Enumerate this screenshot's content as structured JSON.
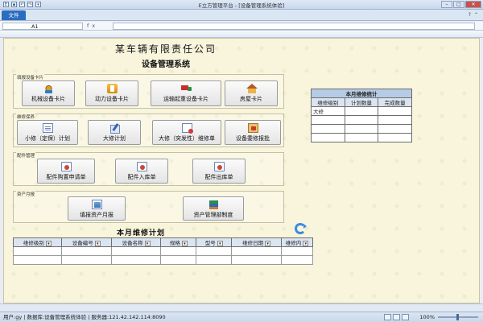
{
  "window": {
    "title": "E立方管理平台 - [设备管理系统体验]"
  },
  "ribbon": {
    "file_tab": "文件"
  },
  "formula_bar": {
    "name_box": "A1",
    "fx": "fx"
  },
  "sheet": {
    "company": "某车辆有限责任公司",
    "system": "设备管理系统",
    "groups": [
      {
        "label": "填报设备卡片",
        "buttons": [
          {
            "label": "机械设备卡片",
            "icon": "gear-icon"
          },
          {
            "label": "动力设备卡片",
            "icon": "power-icon"
          },
          {
            "label": "运输起重设备卡片",
            "icon": "truck-icon"
          },
          {
            "label": "房屋卡片",
            "icon": "house-icon"
          }
        ]
      },
      {
        "label": "维修保养",
        "buttons": [
          {
            "label": "小修（定保）计划",
            "icon": "document-icon"
          },
          {
            "label": "大修计划",
            "icon": "pen-icon"
          },
          {
            "label": "大修（突发性）维修单",
            "icon": "repair-icon"
          },
          {
            "label": "设备委修报批",
            "icon": "approve-icon"
          }
        ]
      },
      {
        "label": "配件管理",
        "buttons": [
          {
            "label": "配件购置申请单",
            "icon": "part-icon"
          },
          {
            "label": "配件入库单",
            "icon": "part-icon"
          },
          {
            "label": "配件出库单",
            "icon": "part-icon"
          }
        ]
      },
      {
        "label": "资产月报",
        "buttons": [
          {
            "label": "填报资产月报",
            "icon": "report-icon"
          },
          {
            "label": "资产管理部制度",
            "icon": "stack-icon"
          }
        ]
      }
    ],
    "stats_table": {
      "caption": "本月维修统计",
      "headers": [
        "维修级别",
        "计划数量",
        "完成数量"
      ],
      "rows": [
        [
          "大修",
          "",
          ""
        ],
        [
          "",
          "",
          ""
        ],
        [
          "",
          "",
          ""
        ],
        [
          "",
          "",
          ""
        ]
      ]
    },
    "plan": {
      "title": "本月维修计划",
      "headers": [
        "维修级别",
        "设备编号",
        "设备名称",
        "规格",
        "型号",
        "维修日期",
        "维修内"
      ],
      "row_count": 2
    }
  },
  "status": {
    "text": "用户:gy | 数据库:设备管理系统体验 | 服务器:121.42.142.114:8090",
    "zoom": "100%"
  }
}
